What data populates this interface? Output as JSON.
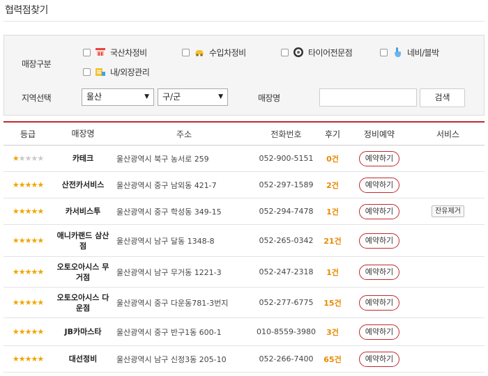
{
  "page": {
    "title": "협력점찾기"
  },
  "search": {
    "type_label": "매장구분",
    "types": [
      {
        "label": "국산차정비",
        "icon": "domestic-car-repair-icon"
      },
      {
        "label": "수입차정비",
        "icon": "imported-car-icon"
      },
      {
        "label": "타이어전문점",
        "icon": "tire-icon"
      },
      {
        "label": "네비/블박",
        "icon": "navigation-touch-icon"
      },
      {
        "label": "내/외장관리",
        "icon": "interior-exterior-care-icon"
      }
    ],
    "region_label": "지역선택",
    "city_value": "울산",
    "district_value": "구/군",
    "store_label": "매장명",
    "store_value": "",
    "search_button": "검색"
  },
  "table": {
    "headers": [
      "등급",
      "매장명",
      "주소",
      "전화번호",
      "후기",
      "정비예약",
      "서비스"
    ],
    "rows": [
      {
        "rating": 1,
        "name": "카테크",
        "address": "울산광역시 북구 농서로 259",
        "phone": "052-900-5151",
        "reviews": "0건",
        "reserve": "예약하기",
        "service": ""
      },
      {
        "rating": 5,
        "name": "산전카서비스",
        "address": "울산광역시 중구 남외동 421-7",
        "phone": "052-297-1589",
        "reviews": "2건",
        "reserve": "예약하기",
        "service": ""
      },
      {
        "rating": 5,
        "name": "카서비스투",
        "address": "울산광역시 중구 학성동 349-15",
        "phone": "052-294-7478",
        "reviews": "1건",
        "reserve": "예약하기",
        "service": "잔유제거"
      },
      {
        "rating": 5,
        "name": "애니카랜드 삼산점",
        "address": "울산광역시 남구 달동 1348-8",
        "phone": "052-265-0342",
        "reviews": "21건",
        "reserve": "예약하기",
        "service": ""
      },
      {
        "rating": 5,
        "name": "오토오아시스 무거점",
        "address": "울산광역시 남구 무거동 1221-3",
        "phone": "052-247-2318",
        "reviews": "1건",
        "reserve": "예약하기",
        "service": ""
      },
      {
        "rating": 5,
        "name": "오토오아시스 다운점",
        "address": "울산광역시 중구 다운동781-3번지",
        "phone": "052-277-6775",
        "reviews": "15건",
        "reserve": "예약하기",
        "service": ""
      },
      {
        "rating": 5,
        "name": "JB카마스타",
        "address": "울산광역시 중구 반구1동 600-1",
        "phone": "010-8559-3980",
        "reviews": "3건",
        "reserve": "예약하기",
        "service": ""
      },
      {
        "rating": 5,
        "name": "대선정비",
        "address": "울산광역시 남구 신정3동 205-10",
        "phone": "052-266-7400",
        "reviews": "65건",
        "reserve": "예약하기",
        "service": ""
      }
    ]
  },
  "colors": {
    "accent": "#c0282d",
    "star": "#f0a500",
    "review": "#e88a00"
  }
}
